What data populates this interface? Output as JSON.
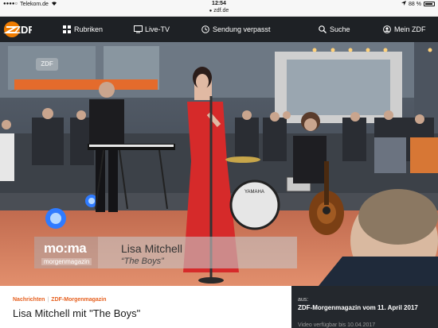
{
  "status_bar": {
    "carrier": "Telekom.de",
    "time": "12:54",
    "battery_percent": "88 %",
    "url": "zdf.de"
  },
  "nav": {
    "logo_text": "ZDF",
    "items": [
      {
        "label": "Rubriken",
        "icon": "grid-icon"
      },
      {
        "label": "Live-TV",
        "icon": "tv-icon"
      },
      {
        "label": "Sendung verpasst",
        "icon": "clock-icon"
      },
      {
        "label": "Suche",
        "icon": "search-icon"
      },
      {
        "label": "Mein ZDF",
        "icon": "user-icon"
      }
    ]
  },
  "video": {
    "show_logo": "mo:ma",
    "show_sub": "morgenmagazin",
    "watermark": "ZDF",
    "artist": "Lisa Mitchell",
    "song": "“The Boys”"
  },
  "info": {
    "breadcrumb": [
      "Nachrichten",
      "ZDF-Morgenmagazin"
    ],
    "title": "Lisa Mitchell mit \"The Boys\"",
    "aus_label": "aus:",
    "aus_title": "ZDF-Morgenmagazin vom 11. April 2017",
    "aus_sub": "Video verfügbar bis 10.04.2017"
  },
  "colors": {
    "brand_orange": "#f07c00",
    "breadcrumb_orange": "#e6601f",
    "nav_bg": "#1e2125"
  }
}
